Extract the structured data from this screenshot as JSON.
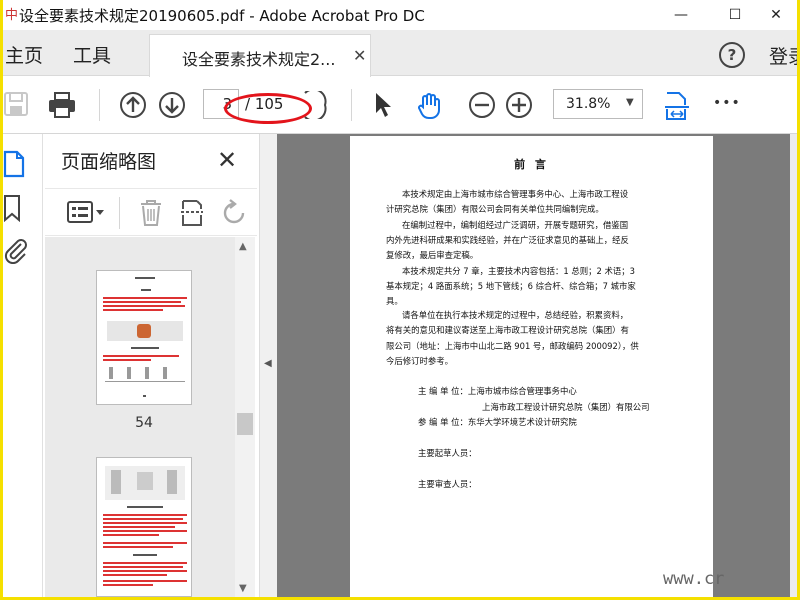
{
  "window": {
    "title": "设全要素技术规定20190605.pdf - Adobe Acrobat Pro DC",
    "app_glyph": "中",
    "minimize": "—",
    "maximize": "☐",
    "close": "✕"
  },
  "menu": {
    "home": "主页",
    "tools": "工具",
    "login": "登录",
    "help": "?"
  },
  "tab": {
    "label": "设全要素技术规定2...",
    "close": "✕"
  },
  "toolbar": {
    "page_current": "3",
    "page_total": "/ 105",
    "zoom": "31.8%",
    "zoom_caret": "▼",
    "more": "•••"
  },
  "thumbnails": {
    "title": "页面缩略图",
    "close": "✕",
    "pages": [
      {
        "number": "54"
      },
      {
        "number": ""
      }
    ]
  },
  "scroll": {
    "up": "▲",
    "down": "▼",
    "collapse": "◀"
  },
  "document": {
    "heading": "前 言",
    "lines": [
      "本技术规定由上海市城市综合管理事务中心、上海市政工程设",
      "计研究总院（集团）有限公司会同有关单位共同编制完成。",
      "在编制过程中，编制组经过广泛调研，开展专题研究，借鉴国",
      "内外先进科研成果和实践经验，并在广泛征求意见的基础上，经反",
      "复修改，最后审查定稿。",
      "本技术规定共分 7 章，主要技术内容包括：1 总则；2 术语；3",
      "基本规定；4 路面系统；5 地下管线；6 综合杆、综合箱；7 城市家",
      "具。",
      "请各单位在执行本技术规定的过程中，总结经验，积累资料，",
      "将有关的意见和建议寄送至上海市政工程设计研究总院（集团）有",
      "限公司（地址：上海市中山北二路 901 号，邮政编码 200092），供",
      "今后修订时参考。",
      "主 编 单 位：上海市城市综合管理事务中心",
      "上海市政工程设计研究总院（集团）有限公司",
      "参 编 单 位：东华大学环境艺术设计研究院",
      "主要起草人员：",
      "主要审查人员："
    ]
  },
  "watermark": "www.cr",
  "colors": {
    "annotation": "#e3141b",
    "accent": "#1473e6",
    "canvas": "#7b7b7b"
  }
}
